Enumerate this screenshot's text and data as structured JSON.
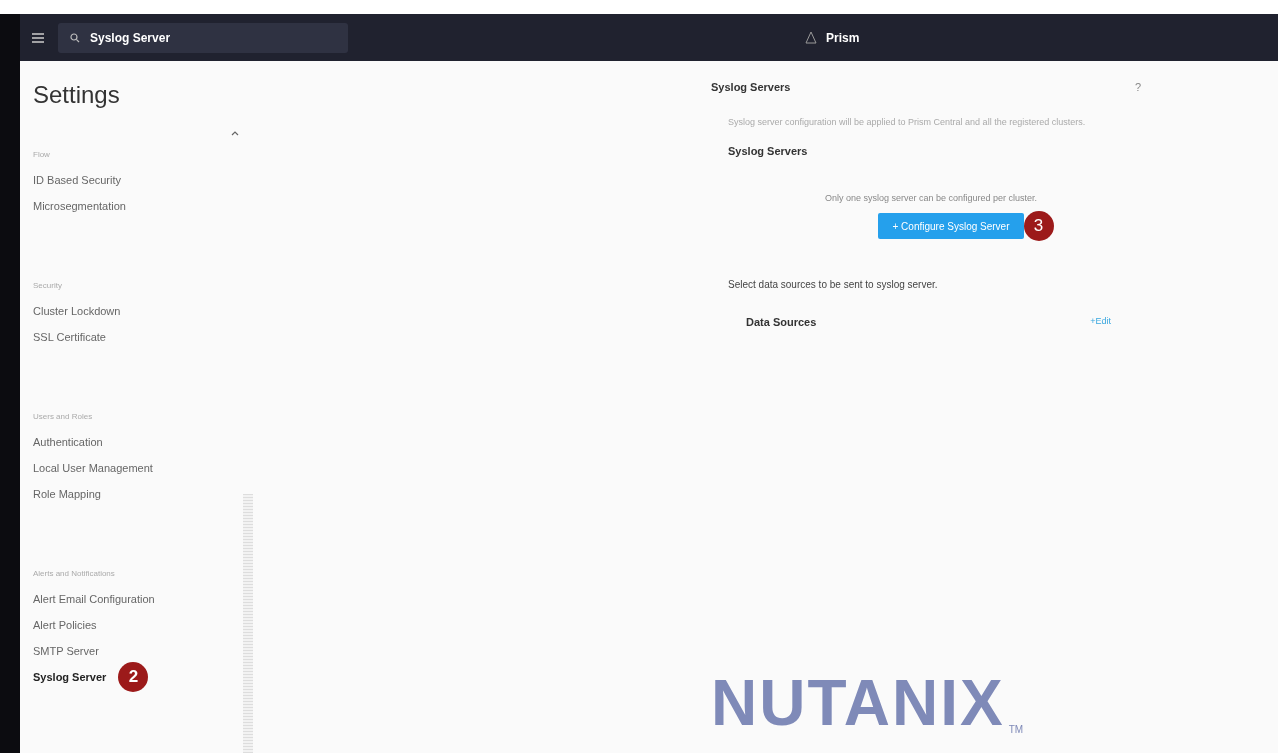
{
  "topbar": {
    "search": {
      "value": "Syslog Server"
    },
    "app_name": "Prism"
  },
  "sidebar": {
    "title": "Settings",
    "groups": [
      {
        "heading": "Flow",
        "items": [
          {
            "label": "ID Based Security",
            "selected": false
          },
          {
            "label": "Microsegmentation",
            "selected": false
          }
        ]
      },
      {
        "heading": "Security",
        "items": [
          {
            "label": "Cluster Lockdown",
            "selected": false
          },
          {
            "label": "SSL Certificate",
            "selected": false
          }
        ]
      },
      {
        "heading": "Users and Roles",
        "items": [
          {
            "label": "Authentication",
            "selected": false
          },
          {
            "label": "Local User Management",
            "selected": false
          },
          {
            "label": "Role Mapping",
            "selected": false
          }
        ]
      },
      {
        "heading": "Alerts and Notifications",
        "items": [
          {
            "label": "Alert Email Configuration",
            "selected": false
          },
          {
            "label": "Alert Policies",
            "selected": false
          },
          {
            "label": "SMTP Server",
            "selected": false
          },
          {
            "label": "Syslog Server",
            "selected": true,
            "step": "2"
          }
        ]
      }
    ]
  },
  "panel": {
    "title": "Syslog Servers",
    "help": "?",
    "description": "Syslog server configuration will be applied to Prism Central and all the registered clusters.",
    "section_title": "Syslog Servers",
    "note": "Only one syslog server can be configured per cluster.",
    "button": {
      "label": "+ Configure Syslog Server",
      "step": "3"
    },
    "sources_hint": "Select data sources to be sent to syslog server.",
    "sources_label": "Data Sources",
    "edit_link": "+Edit"
  },
  "logo": {
    "text": "NUTANIX",
    "mark": "TM"
  }
}
